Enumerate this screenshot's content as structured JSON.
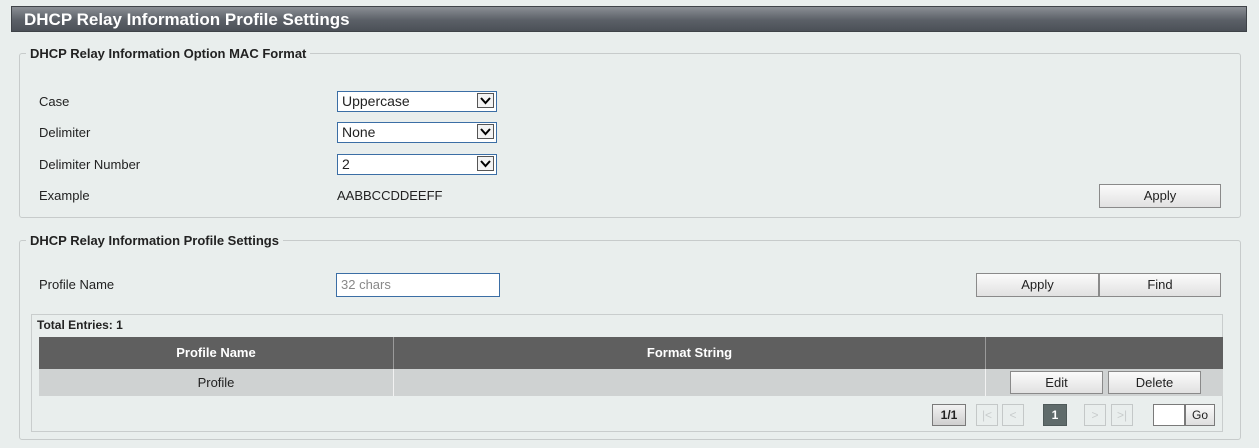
{
  "page_title": "DHCP Relay Information Profile Settings",
  "mac_format": {
    "legend": "DHCP Relay Information Option MAC Format",
    "case_label": "Case",
    "case_value": "Uppercase",
    "delimiter_label": "Delimiter",
    "delimiter_value": "None",
    "delimiter_number_label": "Delimiter Number",
    "delimiter_number_value": "2",
    "example_label": "Example",
    "example_value": "AABBCCDDEEFF",
    "apply_label": "Apply"
  },
  "profile": {
    "legend": "DHCP Relay Information Profile Settings",
    "name_label": "Profile Name",
    "name_placeholder": "32 chars",
    "apply_label": "Apply",
    "find_label": "Find"
  },
  "table": {
    "total_entries": "Total Entries: 1",
    "headers": [
      "Profile Name",
      "Format String",
      ""
    ],
    "rows": [
      {
        "profile_name": "Profile",
        "format_string": "",
        "edit_label": "Edit",
        "delete_label": "Delete"
      }
    ]
  },
  "pagination": {
    "page_info": "1/1",
    "first": "|<",
    "prev": "<",
    "current": "1",
    "next": ">",
    "last": ">|",
    "go_label": "Go"
  },
  "colors": {
    "header_bg": "#5f5f5f",
    "row_bg": "#cfd2d2",
    "title_bg": "#5b6067",
    "page_bg": "#e9eeed"
  }
}
